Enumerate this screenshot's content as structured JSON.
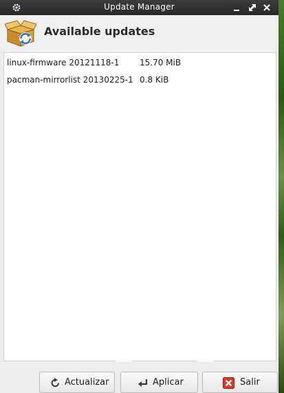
{
  "window": {
    "title": "Update Manager"
  },
  "header": {
    "heading": "Available updates",
    "icon": "package-update-icon"
  },
  "updates": [
    {
      "name": "linux-firmware 20121118-1",
      "size": "15.70 MiB"
    },
    {
      "name": "pacman-mirrorlist 20130225-1",
      "size": "0.8 KiB"
    }
  ],
  "buttons": {
    "refresh": {
      "label": "Actualizar",
      "icon": "refresh-icon"
    },
    "apply": {
      "label": "Aplicar",
      "icon": "enter-arrow-icon"
    },
    "quit": {
      "label": "Salir",
      "icon": "close-icon",
      "icon_color": "#d9372a"
    }
  },
  "colors": {
    "titlebar": "#2c2c2c",
    "window_bg": "#ececec",
    "list_bg": "#ffffff"
  }
}
